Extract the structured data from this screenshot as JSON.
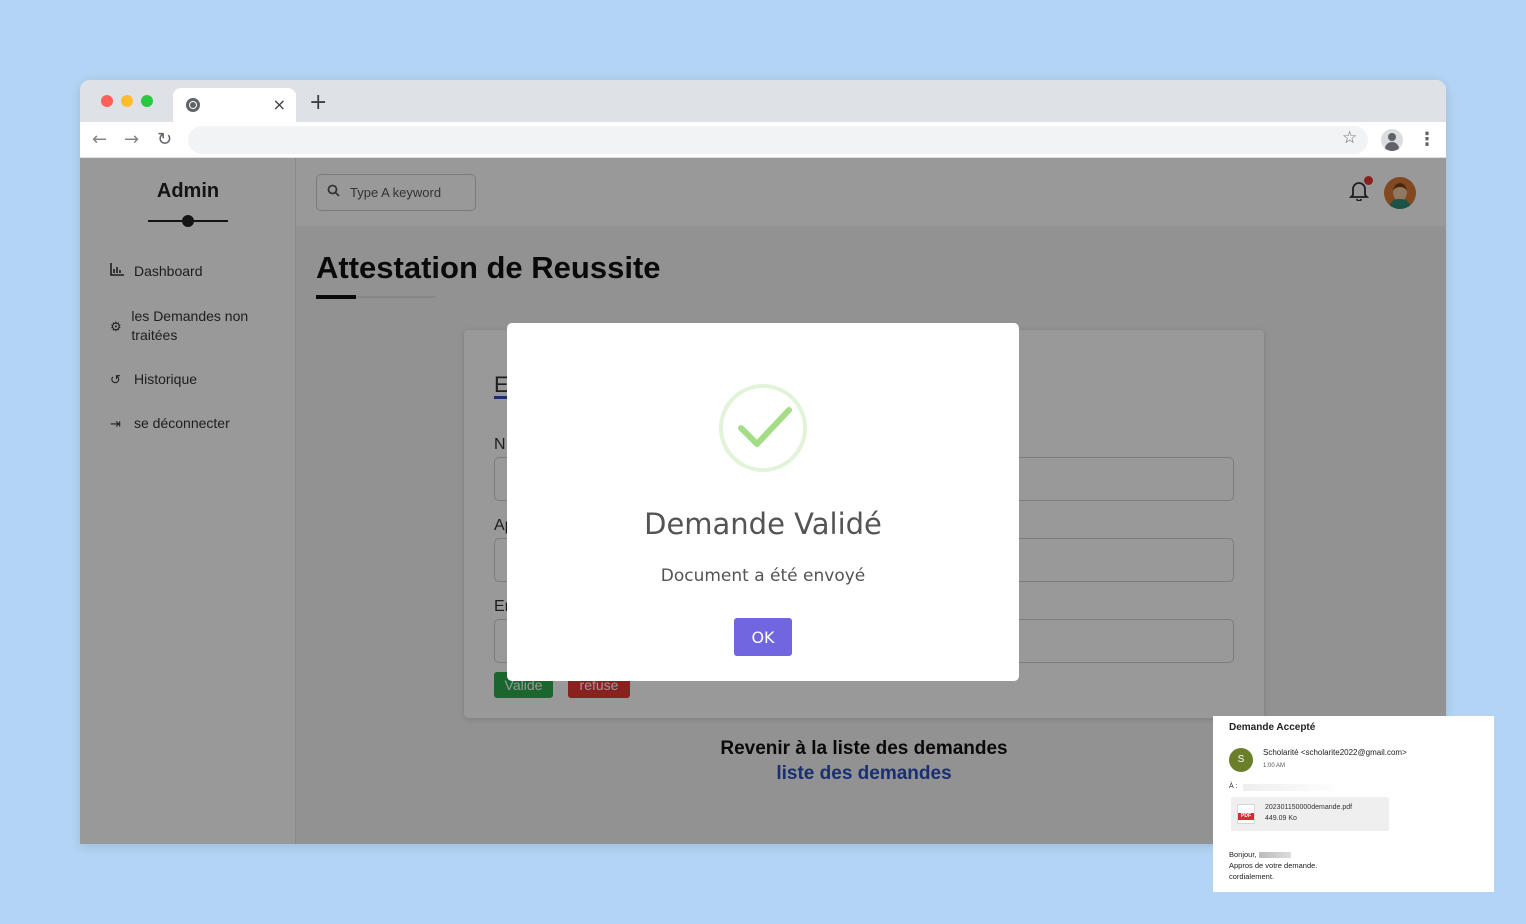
{
  "browser": {
    "tab_close": "×",
    "new_tab": "+"
  },
  "sidebar": {
    "title": "Admin",
    "items": [
      {
        "label": "Dashboard",
        "icon": "chart-icon"
      },
      {
        "label": "les Demandes non traitées",
        "icon": "gear-icon"
      },
      {
        "label": "Historique",
        "icon": "history-icon"
      },
      {
        "label": "se déconnecter",
        "icon": "logout-icon"
      }
    ]
  },
  "topbar": {
    "search_placeholder": "Type A keyword"
  },
  "page": {
    "title": "Attestation de Reussite",
    "card_title": "E",
    "field_labels": [
      "N",
      "Ap",
      "Er"
    ],
    "btn_valide": "Valide",
    "btn_refuse": "refuse",
    "back_text": "Revenir à la liste des demandes",
    "back_link": "liste des demandes"
  },
  "modal": {
    "title": "Demande Validé",
    "text": "Document a été envoyé",
    "ok": "OK"
  },
  "email": {
    "subject": "Demande Accepté",
    "avatar_letter": "S",
    "from": "Scholarité <scholarite2022@gmail.com>",
    "time": "1:00 AM",
    "to_label": "À : ",
    "attachment_name": "202301150000demande.pdf",
    "attachment_size": "449.09 Ko",
    "greeting": "Bonjour,",
    "line1": "Appros de votre demande.",
    "line2": "cordialement."
  },
  "colors": {
    "accent": "#7066e0",
    "success": "#2eaa4f",
    "danger": "#e53935",
    "link": "#2a4fbf"
  }
}
